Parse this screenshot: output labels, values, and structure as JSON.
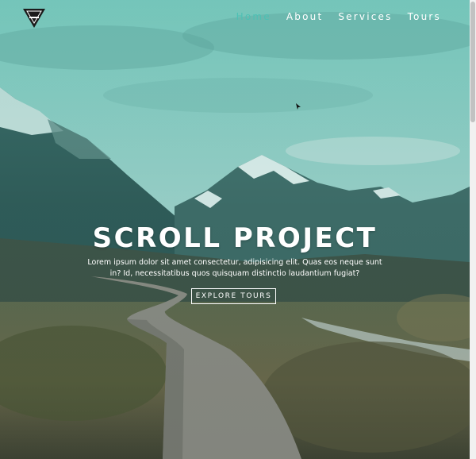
{
  "nav": {
    "logo_icon": "triangle-logo-icon",
    "items": [
      {
        "label": "Home",
        "active": true
      },
      {
        "label": "About",
        "active": false
      },
      {
        "label": "Services",
        "active": false
      },
      {
        "label": "Tours",
        "active": false
      }
    ],
    "active_color": "#4ec0b4"
  },
  "hero": {
    "title": "SCROLL PROJECT",
    "text": "Lorem ipsum dolor sit amet consectetur, adipisicing elit. Quas eos neque sunt in? Id, necessitatibus quos quisquam distinctio laudantium fugiat?",
    "button_label": "EXPLORE TOURS"
  }
}
